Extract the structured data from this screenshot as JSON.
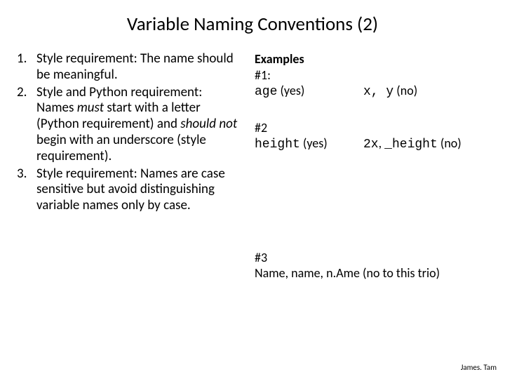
{
  "title": "Variable Naming Conventions (2)",
  "list": {
    "item1": {
      "prefix": "Style requirement: The name should be ",
      "meaningful_text": "meaningful.",
      "suffix": ""
    },
    "item2": {
      "prefix": "Style and Python requirement: Names ",
      "must_text": "must",
      "mid1": " start with a letter (Python requirement) and ",
      "should_not_text": "should not",
      "mid2": " begin with an underscore (style requirement)."
    },
    "item3": "Style requirement: Names are case sensitive but avoid distinguishing variable names only by case."
  },
  "right": {
    "examples_label": "Examples",
    "b1": {
      "num": "#1:",
      "left_code": "age",
      "left_tag": " (yes)",
      "right_code": "x, y",
      "right_tag": " (no)"
    },
    "b2": {
      "num": "#2",
      "left_code": "height",
      "left_tag": " (yes)",
      "right_code1": "2x",
      "right_sep": ", ",
      "right_code2": "_height",
      "right_tag": " (no)"
    },
    "b3": {
      "num": "#3",
      "line": "Name, name, n.Ame (no to this trio)"
    }
  },
  "footer": "James. Tam"
}
